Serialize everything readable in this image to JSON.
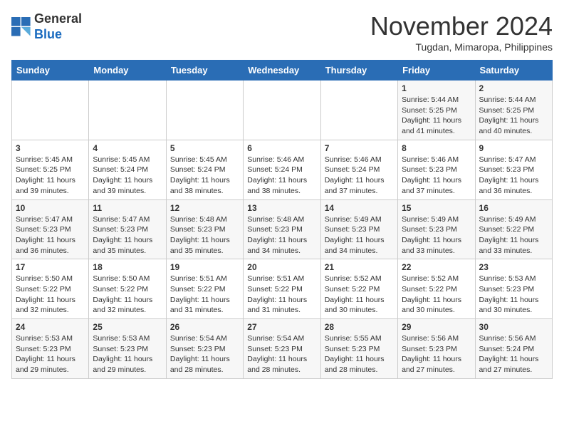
{
  "header": {
    "logo_line1": "General",
    "logo_line2": "Blue",
    "month_title": "November 2024",
    "location": "Tugdan, Mimaropa, Philippines"
  },
  "days_of_week": [
    "Sunday",
    "Monday",
    "Tuesday",
    "Wednesday",
    "Thursday",
    "Friday",
    "Saturday"
  ],
  "weeks": [
    {
      "days": [
        {
          "num": "",
          "info": ""
        },
        {
          "num": "",
          "info": ""
        },
        {
          "num": "",
          "info": ""
        },
        {
          "num": "",
          "info": ""
        },
        {
          "num": "",
          "info": ""
        },
        {
          "num": "1",
          "info": "Sunrise: 5:44 AM\nSunset: 5:25 PM\nDaylight: 11 hours\nand 41 minutes."
        },
        {
          "num": "2",
          "info": "Sunrise: 5:44 AM\nSunset: 5:25 PM\nDaylight: 11 hours\nand 40 minutes."
        }
      ]
    },
    {
      "days": [
        {
          "num": "3",
          "info": "Sunrise: 5:45 AM\nSunset: 5:25 PM\nDaylight: 11 hours\nand 39 minutes."
        },
        {
          "num": "4",
          "info": "Sunrise: 5:45 AM\nSunset: 5:24 PM\nDaylight: 11 hours\nand 39 minutes."
        },
        {
          "num": "5",
          "info": "Sunrise: 5:45 AM\nSunset: 5:24 PM\nDaylight: 11 hours\nand 38 minutes."
        },
        {
          "num": "6",
          "info": "Sunrise: 5:46 AM\nSunset: 5:24 PM\nDaylight: 11 hours\nand 38 minutes."
        },
        {
          "num": "7",
          "info": "Sunrise: 5:46 AM\nSunset: 5:24 PM\nDaylight: 11 hours\nand 37 minutes."
        },
        {
          "num": "8",
          "info": "Sunrise: 5:46 AM\nSunset: 5:23 PM\nDaylight: 11 hours\nand 37 minutes."
        },
        {
          "num": "9",
          "info": "Sunrise: 5:47 AM\nSunset: 5:23 PM\nDaylight: 11 hours\nand 36 minutes."
        }
      ]
    },
    {
      "days": [
        {
          "num": "10",
          "info": "Sunrise: 5:47 AM\nSunset: 5:23 PM\nDaylight: 11 hours\nand 36 minutes."
        },
        {
          "num": "11",
          "info": "Sunrise: 5:47 AM\nSunset: 5:23 PM\nDaylight: 11 hours\nand 35 minutes."
        },
        {
          "num": "12",
          "info": "Sunrise: 5:48 AM\nSunset: 5:23 PM\nDaylight: 11 hours\nand 35 minutes."
        },
        {
          "num": "13",
          "info": "Sunrise: 5:48 AM\nSunset: 5:23 PM\nDaylight: 11 hours\nand 34 minutes."
        },
        {
          "num": "14",
          "info": "Sunrise: 5:49 AM\nSunset: 5:23 PM\nDaylight: 11 hours\nand 34 minutes."
        },
        {
          "num": "15",
          "info": "Sunrise: 5:49 AM\nSunset: 5:23 PM\nDaylight: 11 hours\nand 33 minutes."
        },
        {
          "num": "16",
          "info": "Sunrise: 5:49 AM\nSunset: 5:22 PM\nDaylight: 11 hours\nand 33 minutes."
        }
      ]
    },
    {
      "days": [
        {
          "num": "17",
          "info": "Sunrise: 5:50 AM\nSunset: 5:22 PM\nDaylight: 11 hours\nand 32 minutes."
        },
        {
          "num": "18",
          "info": "Sunrise: 5:50 AM\nSunset: 5:22 PM\nDaylight: 11 hours\nand 32 minutes."
        },
        {
          "num": "19",
          "info": "Sunrise: 5:51 AM\nSunset: 5:22 PM\nDaylight: 11 hours\nand 31 minutes."
        },
        {
          "num": "20",
          "info": "Sunrise: 5:51 AM\nSunset: 5:22 PM\nDaylight: 11 hours\nand 31 minutes."
        },
        {
          "num": "21",
          "info": "Sunrise: 5:52 AM\nSunset: 5:22 PM\nDaylight: 11 hours\nand 30 minutes."
        },
        {
          "num": "22",
          "info": "Sunrise: 5:52 AM\nSunset: 5:22 PM\nDaylight: 11 hours\nand 30 minutes."
        },
        {
          "num": "23",
          "info": "Sunrise: 5:53 AM\nSunset: 5:23 PM\nDaylight: 11 hours\nand 30 minutes."
        }
      ]
    },
    {
      "days": [
        {
          "num": "24",
          "info": "Sunrise: 5:53 AM\nSunset: 5:23 PM\nDaylight: 11 hours\nand 29 minutes."
        },
        {
          "num": "25",
          "info": "Sunrise: 5:53 AM\nSunset: 5:23 PM\nDaylight: 11 hours\nand 29 minutes."
        },
        {
          "num": "26",
          "info": "Sunrise: 5:54 AM\nSunset: 5:23 PM\nDaylight: 11 hours\nand 28 minutes."
        },
        {
          "num": "27",
          "info": "Sunrise: 5:54 AM\nSunset: 5:23 PM\nDaylight: 11 hours\nand 28 minutes."
        },
        {
          "num": "28",
          "info": "Sunrise: 5:55 AM\nSunset: 5:23 PM\nDaylight: 11 hours\nand 28 minutes."
        },
        {
          "num": "29",
          "info": "Sunrise: 5:56 AM\nSunset: 5:23 PM\nDaylight: 11 hours\nand 27 minutes."
        },
        {
          "num": "30",
          "info": "Sunrise: 5:56 AM\nSunset: 5:24 PM\nDaylight: 11 hours\nand 27 minutes."
        }
      ]
    }
  ]
}
